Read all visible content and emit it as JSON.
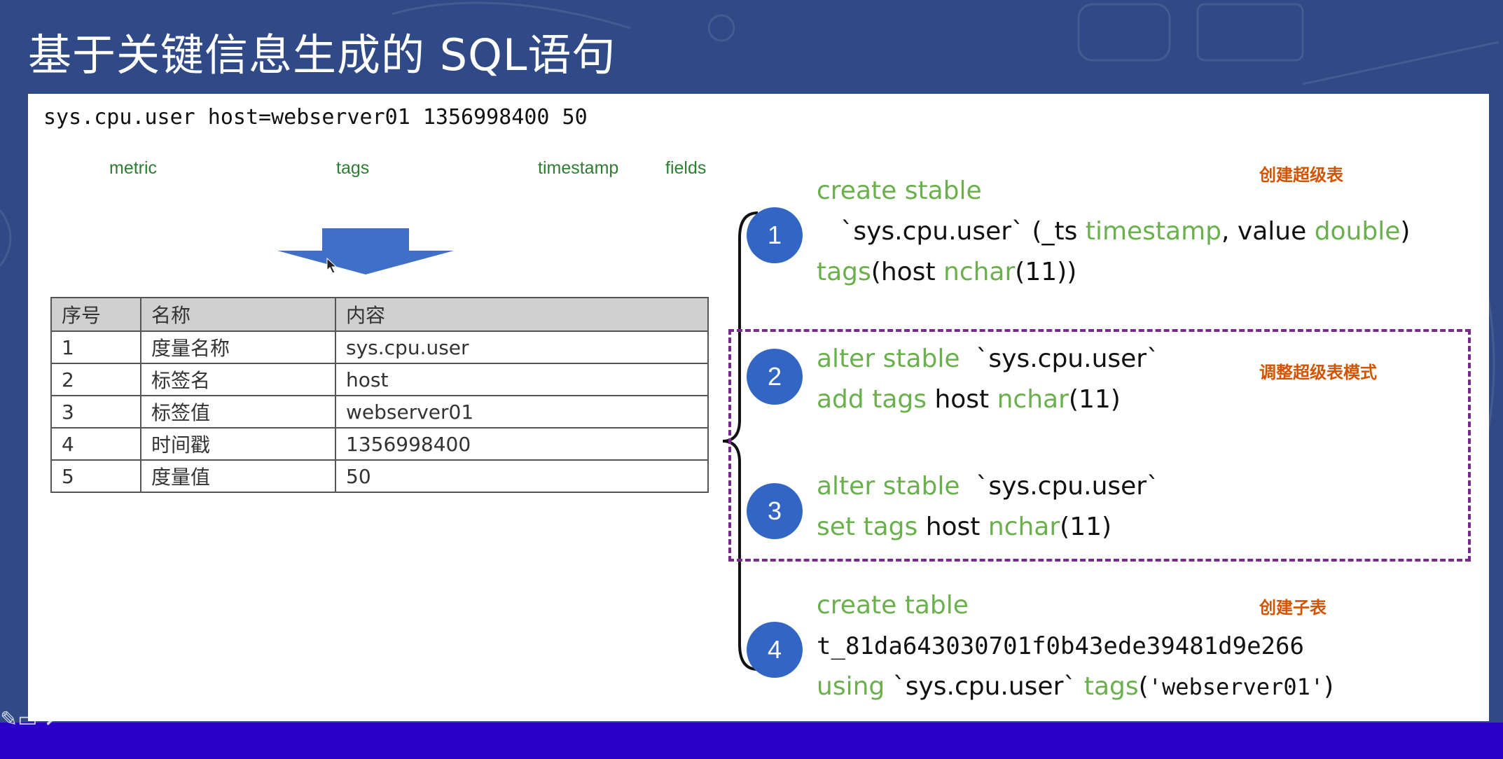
{
  "title": "基于关键信息生成的 SQL语句",
  "raw_line": "sys.cpu.user host=webserver01 1356998400 50",
  "labels": {
    "metric": "metric",
    "tags": "tags",
    "timestamp": "timestamp",
    "fields": "fields"
  },
  "table": {
    "headers": [
      "序号",
      "名称",
      "内容"
    ],
    "rows": [
      [
        "1",
        "度量名称",
        "sys.cpu.user"
      ],
      [
        "2",
        "标签名",
        "host"
      ],
      [
        "3",
        "标签值",
        "webserver01"
      ],
      [
        "4",
        "时间戳",
        "1356998400"
      ],
      [
        "5",
        "度量值",
        "50"
      ]
    ]
  },
  "steps": [
    {
      "number": "1",
      "note": "创建超级表",
      "line1_kw": "create stable",
      "line2_a": "`sys.cpu.user` (_ts ",
      "line2_kw1": "timestamp",
      "line2_b": ", value ",
      "line2_kw2": "double",
      "line2_c": ")",
      "line3_kw": "tags",
      "line3_a": "(host ",
      "line3_kw2": "nchar",
      "line3_b": "(11))"
    },
    {
      "number": "2",
      "note": "调整超级表模式",
      "line1_kw": "alter stable",
      "line1_a": "  `sys.cpu.user`",
      "line2_kw": "add tags",
      "line2_a": " host ",
      "line2_kw2": "nchar",
      "line2_b": "(11)"
    },
    {
      "number": "3",
      "line1_kw": "alter stable",
      "line1_a": "  `sys.cpu.user`",
      "line2_kw": "set tags",
      "line2_a": " host ",
      "line2_kw2": "nchar",
      "line2_b": "(11)"
    },
    {
      "number": "4",
      "note": "创建子表",
      "line1_kw": "create table",
      "line2": "t_81da643030701f0b43ede39481d9e266",
      "line3_kw": "using",
      "line3_a": " `sys.cpu.user` ",
      "line3_kw2": "tags",
      "line3_b": "(",
      "line3_str": "'webserver01'",
      "line3_c": ")"
    }
  ],
  "colors": {
    "background": "#2f4a86",
    "keyword": "#6ab04c",
    "note": "#d35400",
    "circle": "#3366c4",
    "dashed_border": "#7a2a8e",
    "bottom_bar": "#2a00c8"
  }
}
